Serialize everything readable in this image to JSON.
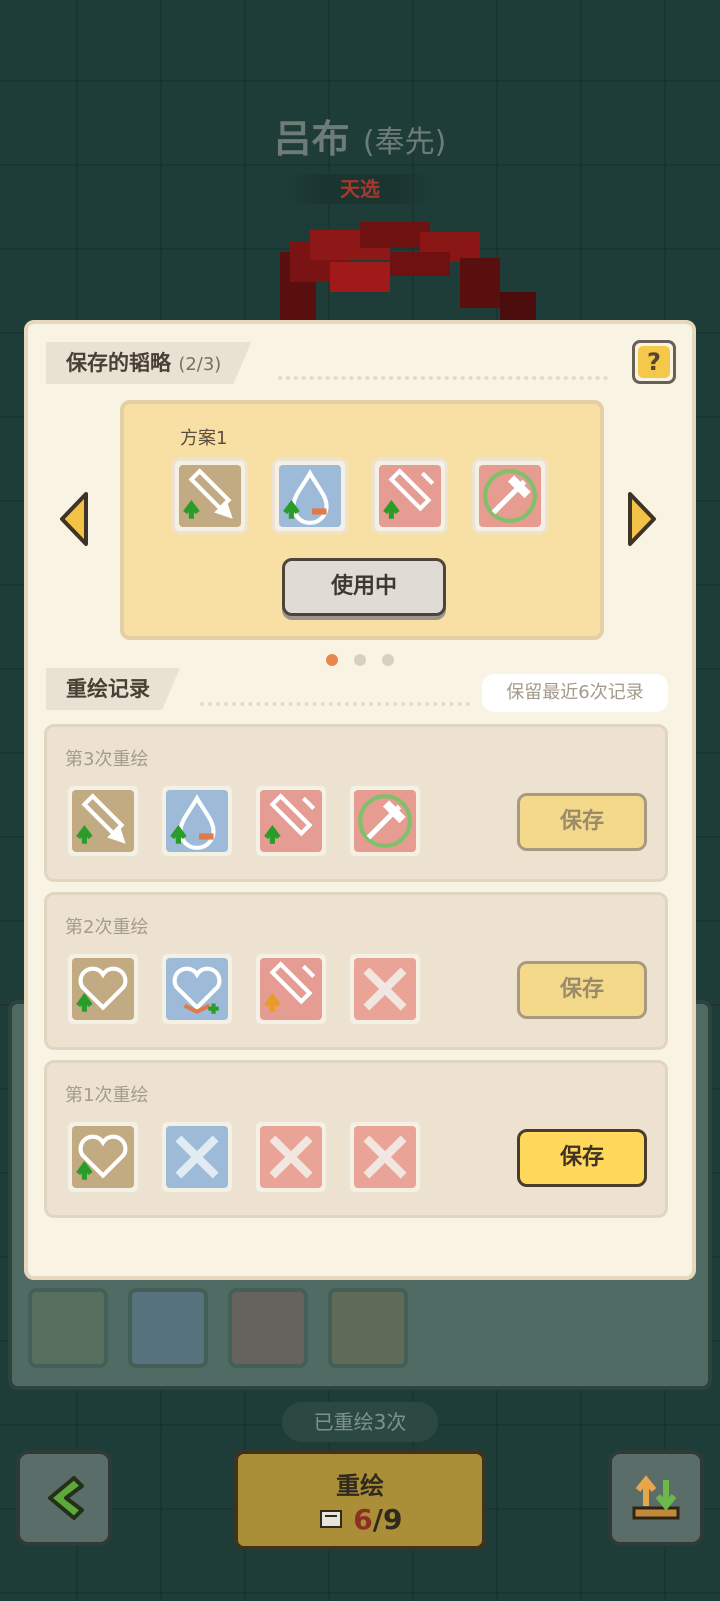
{
  "hero": {
    "name": "吕布",
    "alias": "(奉先)",
    "tag": "天选"
  },
  "modal": {
    "saved_title": "保存的韬略",
    "saved_count": "(2/3)",
    "help_label": "?",
    "plan": {
      "name": "方案1",
      "status_button": "使用中",
      "icons": [
        "sword-up",
        "water-up",
        "sword-red-up",
        "axe-green"
      ]
    },
    "page_dots": 3,
    "active_page": 0,
    "records_title": "重绘记录",
    "keep_note": "保留最近6次记录",
    "records": [
      {
        "title": "第3次重绘",
        "save_label": "保存",
        "active": false,
        "icons": [
          "sword-up",
          "water-up",
          "sword-red-up",
          "axe-green"
        ]
      },
      {
        "title": "第2次重绘",
        "save_label": "保存",
        "active": false,
        "icons": [
          "heart-up",
          "heart-blue-plus",
          "sword-red-orange",
          "crossed-swords-red"
        ]
      },
      {
        "title": "第1次重绘",
        "save_label": "保存",
        "active": true,
        "icons": [
          "heart-up",
          "crossed-swords-blue",
          "crossed-swords-red",
          "crossed-swords-red"
        ]
      }
    ]
  },
  "bottom": {
    "redraw_count_text": "已重绘3次",
    "redraw_label": "重绘",
    "redraw_used": "6",
    "redraw_total": "/9"
  },
  "colors": {
    "background": "#1f3d38",
    "modal": "#f9f3e4",
    "plan_card": "#f8dfa4",
    "save_active": "#ffd85c",
    "dot_active": "#e8874c"
  }
}
